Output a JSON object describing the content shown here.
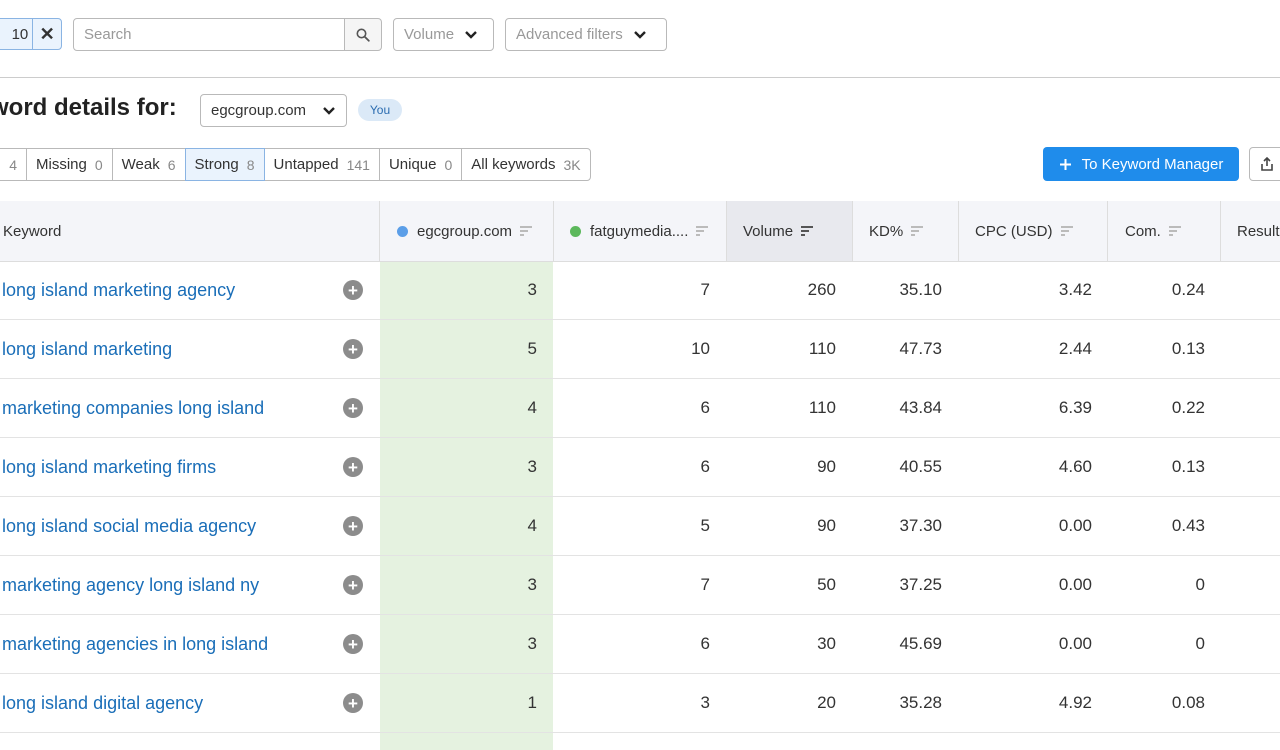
{
  "filters": {
    "chip_value": "10",
    "search_placeholder": "Search",
    "volume_label": "Volume",
    "advanced_label": "Advanced filters"
  },
  "header": {
    "title": "word details for:",
    "domain": "egcgroup.com",
    "you_badge": "You"
  },
  "tabs": [
    {
      "label": "",
      "count": "4"
    },
    {
      "label": "Missing",
      "count": "0"
    },
    {
      "label": "Weak",
      "count": "6"
    },
    {
      "label": "Strong",
      "count": "8"
    },
    {
      "label": "Untapped",
      "count": "141"
    },
    {
      "label": "Unique",
      "count": "0"
    },
    {
      "label": "All keywords",
      "count": "3K"
    }
  ],
  "actions": {
    "keyword_manager": "To Keyword Manager"
  },
  "colors": {
    "accent": "#1f8ceb",
    "egc_dot": "#5b9ee8",
    "fatguy_dot": "#5cb85c",
    "highlight_col": "#e5f2e0"
  },
  "table": {
    "columns": {
      "keyword": "Keyword",
      "egc": "egcgroup.com",
      "fatguy": "fatguymedia....",
      "volume": "Volume",
      "kd": "KD%",
      "cpc": "CPC (USD)",
      "com": "Com.",
      "results": "Result"
    },
    "rows": [
      {
        "keyword": "long island marketing agency",
        "egc": "3",
        "fatguy": "7",
        "volume": "260",
        "kd": "35.10",
        "cpc": "3.42",
        "com": "0.24"
      },
      {
        "keyword": "long island marketing",
        "egc": "5",
        "fatguy": "10",
        "volume": "110",
        "kd": "47.73",
        "cpc": "2.44",
        "com": "0.13"
      },
      {
        "keyword": "marketing companies long island",
        "egc": "4",
        "fatguy": "6",
        "volume": "110",
        "kd": "43.84",
        "cpc": "6.39",
        "com": "0.22"
      },
      {
        "keyword": "long island marketing firms",
        "egc": "3",
        "fatguy": "6",
        "volume": "90",
        "kd": "40.55",
        "cpc": "4.60",
        "com": "0.13"
      },
      {
        "keyword": "long island social media agency",
        "egc": "4",
        "fatguy": "5",
        "volume": "90",
        "kd": "37.30",
        "cpc": "0.00",
        "com": "0.43"
      },
      {
        "keyword": "marketing agency long island ny",
        "egc": "3",
        "fatguy": "7",
        "volume": "50",
        "kd": "37.25",
        "cpc": "0.00",
        "com": "0"
      },
      {
        "keyword": "marketing agencies in long island",
        "egc": "3",
        "fatguy": "6",
        "volume": "30",
        "kd": "45.69",
        "cpc": "0.00",
        "com": "0"
      },
      {
        "keyword": "long island digital agency",
        "egc": "1",
        "fatguy": "3",
        "volume": "20",
        "kd": "35.28",
        "cpc": "4.92",
        "com": "0.08"
      }
    ]
  }
}
